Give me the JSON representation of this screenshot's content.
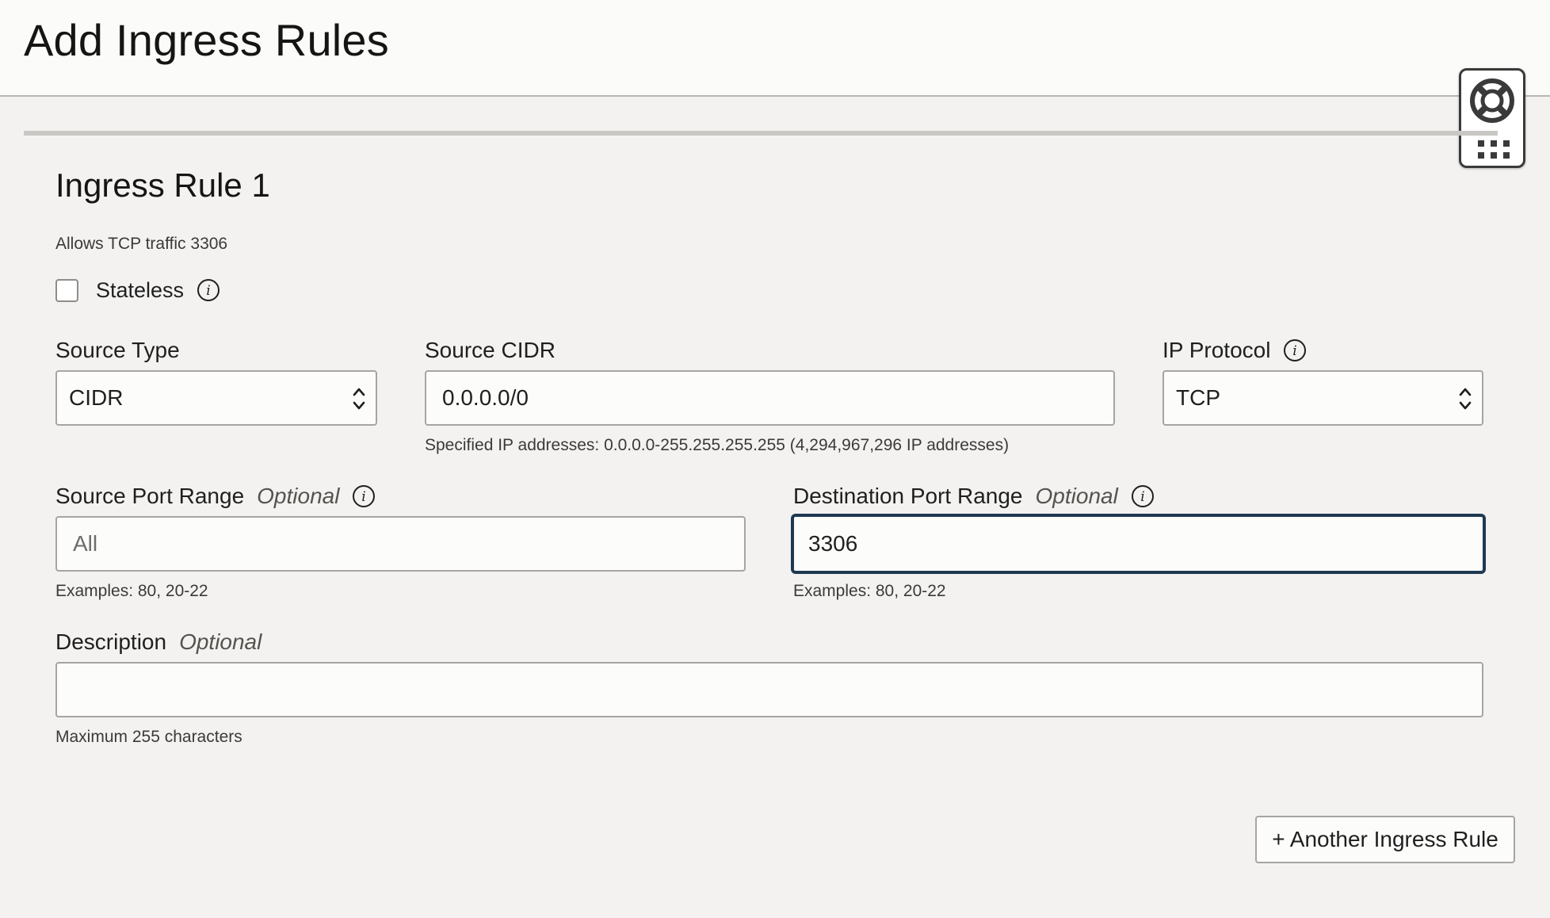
{
  "header": {
    "title": "Add Ingress Rules"
  },
  "rule": {
    "title": "Ingress Rule 1",
    "summary": "Allows TCP traffic 3306",
    "stateless": {
      "label": "Stateless",
      "checked": false
    },
    "source_type": {
      "label": "Source Type",
      "value": "CIDR"
    },
    "source_cidr": {
      "label": "Source CIDR",
      "value": "0.0.0.0/0",
      "helper": "Specified IP addresses: 0.0.0.0-255.255.255.255 (4,294,967,296 IP addresses)"
    },
    "ip_protocol": {
      "label": "IP Protocol",
      "value": "TCP"
    },
    "source_port_range": {
      "label": "Source Port Range",
      "optional": "Optional",
      "placeholder": "All",
      "value": "",
      "helper": "Examples: 80, 20-22"
    },
    "destination_port_range": {
      "label": "Destination Port Range",
      "optional": "Optional",
      "value": "3306",
      "helper": "Examples: 80, 20-22"
    },
    "description": {
      "label": "Description",
      "optional": "Optional",
      "value": "",
      "helper": "Maximum 255 characters"
    }
  },
  "actions": {
    "add_rule_label": "+ Another Ingress Rule"
  },
  "colors": {
    "background": "#f3f2f1",
    "focus_border": "#1f3a52",
    "input_border": "#a7a5a2"
  },
  "icons": {
    "help": "lifebuoy-icon",
    "grid": "grid-dots-icon",
    "info": "info-icon",
    "select": "chevron-up-down-icon"
  }
}
